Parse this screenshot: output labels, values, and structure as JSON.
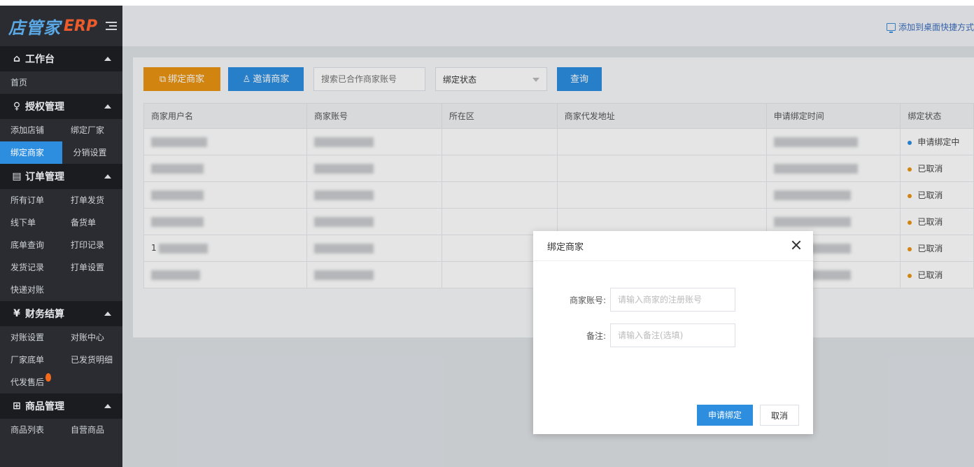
{
  "app": {
    "brand": "店管家",
    "erp": "ERP"
  },
  "header": {
    "shortcut_label": "添加到桌面快捷方式"
  },
  "sidebar": {
    "sections": [
      {
        "title": "工作台",
        "icon": "home-icon",
        "rows": [
          [
            "首页"
          ]
        ]
      },
      {
        "title": "授权管理",
        "icon": "user-icon",
        "rows": [
          [
            "添加店铺",
            "绑定厂家"
          ],
          [
            "绑定商家",
            "分销设置"
          ]
        ],
        "active": "绑定商家"
      },
      {
        "title": "订单管理",
        "icon": "order-icon",
        "rows": [
          [
            "所有订单",
            "打单发货"
          ],
          [
            "线下单",
            "备货单"
          ],
          [
            "底单查询",
            "打印记录"
          ],
          [
            "发货记录",
            "打单设置"
          ],
          [
            "快递对账"
          ]
        ]
      },
      {
        "title": "财务结算",
        "icon": "yuan-icon",
        "rows": [
          [
            "对账设置",
            "对账中心"
          ],
          [
            "厂家底单",
            "已发货明细"
          ],
          [
            "代发售后"
          ]
        ]
      },
      {
        "title": "商品管理",
        "icon": "grid-icon",
        "rows": [
          [
            "商品列表",
            "自营商品"
          ]
        ]
      }
    ]
  },
  "toolbar": {
    "bind_label": "绑定商家",
    "invite_label": "邀请商家",
    "search_placeholder": "搜索已合作商家账号",
    "status_select": "绑定状态",
    "query_label": "查询"
  },
  "table": {
    "columns": [
      "商家用户名",
      "商家账号",
      "所在区",
      "商家代发地址",
      "申请绑定时间",
      "绑定状态"
    ],
    "rows": [
      {
        "status": "申请绑定中",
        "color": "#2d8ee0"
      },
      {
        "status": "已取消",
        "color": "#e99412"
      },
      {
        "status": "已取消",
        "color": "#e99412"
      },
      {
        "status": "已取消",
        "color": "#e99412"
      },
      {
        "status": "已取消",
        "color": "#e99412",
        "prefix": "1"
      },
      {
        "status": "已取消",
        "color": "#e99412"
      }
    ]
  },
  "modal": {
    "title": "绑定商家",
    "account_label": "商家账号:",
    "account_placeholder": "请输入商家的注册账号",
    "remark_label": "备注:",
    "remark_placeholder": "请输入备注(选填)",
    "submit_label": "申请绑定",
    "cancel_label": "取消"
  }
}
